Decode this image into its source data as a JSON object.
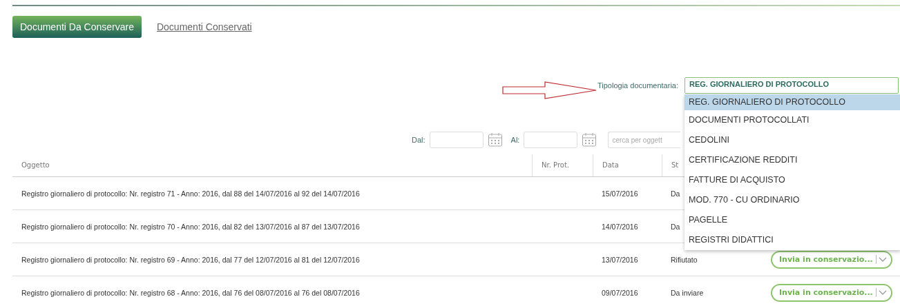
{
  "tabs": [
    {
      "label": "Documenti Da Conservare",
      "selected": true
    },
    {
      "label": "Documenti Conservati",
      "selected": false
    }
  ],
  "type_filter": {
    "label": "Tipologia documentaria:",
    "value": "REG. GIORNALIERO DI PROTOCOLLO",
    "expanded": true,
    "options": [
      {
        "label": "REG. GIORNALIERO DI PROTOCOLLO",
        "selected": true
      },
      {
        "label": "DOCUMENTI PROTOCOLLATI",
        "selected": false
      },
      {
        "label": "CEDOLINI",
        "selected": false
      },
      {
        "label": "CERTIFICAZIONE REDDITI",
        "selected": false
      },
      {
        "label": "FATTURE DI ACQUISTO",
        "selected": false
      },
      {
        "label": "MOD. 770 - CU ORDINARIO",
        "selected": false
      },
      {
        "label": "PAGELLE",
        "selected": false
      },
      {
        "label": "REGISTRI DIDATTICI",
        "selected": false
      }
    ]
  },
  "filters": {
    "from_label": "Dal:",
    "to_label": "Al:",
    "search_placeholder": "cerca per oggett"
  },
  "table": {
    "columns": [
      "Oggetto",
      "Nr. Prot.",
      "Data",
      "St"
    ],
    "rows": [
      {
        "oggetto": "Registro giornaliero di protocollo: Nr. registro 71 - Anno: 2016, dal 88 del 14/07/2016 al 92 del 14/07/2016",
        "data": "15/07/2016",
        "stato": "Da"
      },
      {
        "oggetto": "Registro giornaliero di protocollo: Nr. registro 70 - Anno: 2016, dal 82 del 13/07/2016 al 87 del 13/07/2016",
        "data": "14/07/2016",
        "stato": "Da"
      },
      {
        "oggetto": "Registro giornaliero di protocollo: Nr. registro 69 - Anno: 2016, dal 77 del 12/07/2016 al 81 del 12/07/2016",
        "data": "13/07/2016",
        "stato": "Rifiutato",
        "action": "Invia in conservazio..."
      },
      {
        "oggetto": "Registro giornaliero di protocollo: Nr. registro 68 - Anno: 2016, dal 76 del 08/07/2016 al 76 del 08/07/2016",
        "data": "09/07/2016",
        "stato": "Da inviare",
        "action": "Invia in conservazio..."
      }
    ]
  }
}
